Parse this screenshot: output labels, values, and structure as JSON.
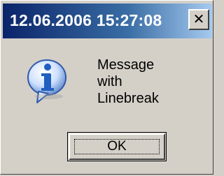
{
  "window": {
    "title": "12.06.2006 15:27:08",
    "close_glyph": "✕"
  },
  "icon": {
    "name": "info-icon",
    "glyph": "i",
    "color": "#1f5fbf"
  },
  "message": {
    "lines": [
      "Message",
      "with",
      "Linebreak"
    ]
  },
  "buttons": {
    "ok_label": "OK"
  }
}
